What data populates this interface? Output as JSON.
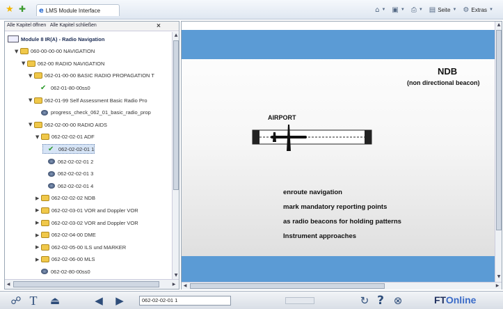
{
  "browser": {
    "tab_title": "LMS Module Interface",
    "tools": [
      {
        "icon": "home-icon",
        "label": ""
      },
      {
        "icon": "feeds-icon",
        "label": ""
      },
      {
        "icon": "print-icon",
        "label": ""
      },
      {
        "icon": "page-icon",
        "label": "Seite"
      },
      {
        "icon": "tools-icon",
        "label": "Extras"
      }
    ]
  },
  "sidebar": {
    "expand_all": "Alle Kapitel öffnen",
    "collapse_all": "Alle Kapitel schließen",
    "close_symbol": "×",
    "tree": [
      {
        "label": "Module 8 IR(A) - Radio Navigation",
        "icon": "book",
        "level": 0,
        "expander": ""
      },
      {
        "label": "060-00-00-00 NAVIGATION",
        "icon": "folder",
        "level": 1,
        "expander": "open"
      },
      {
        "label": "062-00 RADIO NAVIGATION",
        "icon": "folder",
        "level": 2,
        "expander": "open"
      },
      {
        "label": "062-01-00-00 BASIC RADIO PROPAGATION T",
        "icon": "folder",
        "level": 3,
        "expander": "open"
      },
      {
        "label": "062-01-80-00ss0",
        "icon": "check",
        "level": 4,
        "expander": ""
      },
      {
        "label": "062-01-99 Self Assessment Basic Radio Pro",
        "icon": "folder",
        "level": 3,
        "expander": "open"
      },
      {
        "label": "progress_check_062_01_basic_radio_prop",
        "icon": "disc",
        "level": 4,
        "expander": ""
      },
      {
        "label": "062-02-00-00 RADIO AIDS",
        "icon": "folder",
        "level": 3,
        "expander": "open"
      },
      {
        "label": "062-02-02-01 ADF",
        "icon": "folder",
        "level": 4,
        "expander": "open"
      },
      {
        "label": "062-02-02-01 1",
        "icon": "check",
        "level": 5,
        "expander": "",
        "selected": true
      },
      {
        "label": "062-02-02-01 2",
        "icon": "disc",
        "level": 5,
        "expander": ""
      },
      {
        "label": "062-02-02-01 3",
        "icon": "disc",
        "level": 5,
        "expander": ""
      },
      {
        "label": "062-02-02-01 4",
        "icon": "disc",
        "level": 5,
        "expander": ""
      },
      {
        "label": "062-02-02-02 NDB",
        "icon": "folder",
        "level": 4,
        "expander": "closed"
      },
      {
        "label": "062-02-03-01 VOR and Doppler VOR",
        "icon": "folder",
        "level": 4,
        "expander": "closed"
      },
      {
        "label": "062-02-03-02 VOR and Doppler VOR",
        "icon": "folder",
        "level": 4,
        "expander": "closed"
      },
      {
        "label": "062-02-04-00 DME",
        "icon": "folder",
        "level": 4,
        "expander": "closed"
      },
      {
        "label": "062-02-05-00 ILS und MARKER",
        "icon": "folder",
        "level": 4,
        "expander": "closed"
      },
      {
        "label": "062-02-06-00 MLS",
        "icon": "folder",
        "level": 4,
        "expander": "closed"
      },
      {
        "label": "062-02-80-00ss0",
        "icon": "disc",
        "level": 4,
        "expander": ""
      }
    ]
  },
  "slide": {
    "title": "NDB",
    "subtitle": "(non directional beacon)",
    "airport_label": "AIRPORT",
    "bullets": [
      "enroute navigation",
      "mark mandatory reporting points",
      "as radio beacons for holding patterns",
      "Instrument approaches"
    ],
    "band_color": "#5b9bd5"
  },
  "footer": {
    "current_location": "062-02-02-01 1",
    "help_symbol": "?",
    "logo_text": "FTOnline",
    "logo_main": "FT",
    "logo_accent": "Online"
  }
}
